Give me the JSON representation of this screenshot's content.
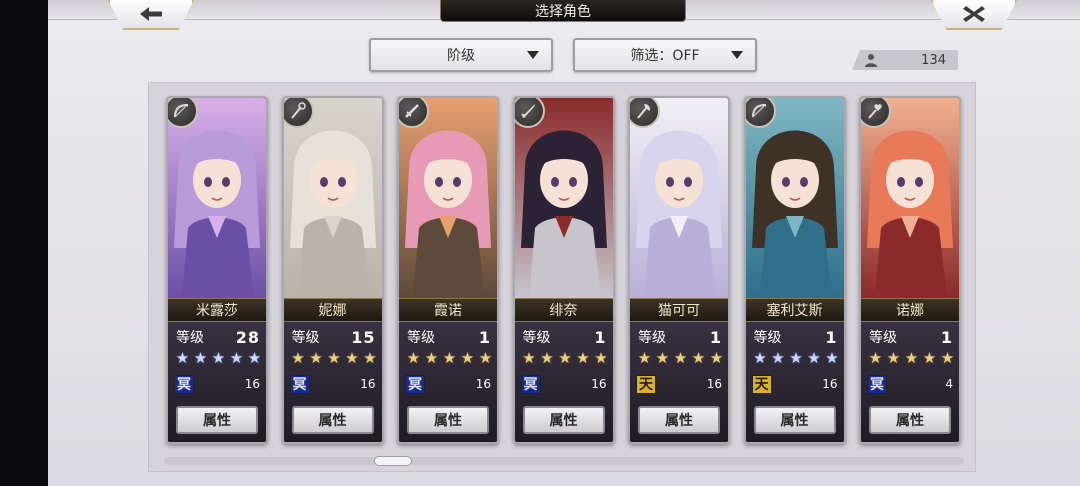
{
  "header": {
    "title": "选择角色",
    "back_icon": "back-arrow-icon",
    "close_icon": "close-icon"
  },
  "filters": {
    "grade_label": "阶级",
    "filter_label": "筛选：OFF"
  },
  "roster_count": "134",
  "level_label": "等级",
  "attribute_button": "属性",
  "characters": [
    {
      "name": "米露莎",
      "level": "28",
      "stars": 5,
      "star_color": "blue",
      "element": "冥",
      "element_type": "dark",
      "count": "16",
      "class_icon": "bow-icon"
    },
    {
      "name": "妮娜",
      "level": "15",
      "stars": 5,
      "star_color": "gold",
      "element": "冥",
      "element_type": "dark",
      "count": "16",
      "class_icon": "staff-icon"
    },
    {
      "name": "霞诺",
      "level": "1",
      "stars": 5,
      "star_color": "gold",
      "element": "冥",
      "element_type": "dark",
      "count": "16",
      "class_icon": "sword-icon"
    },
    {
      "name": "绯奈",
      "level": "1",
      "stars": 5,
      "star_color": "gold",
      "element": "冥",
      "element_type": "dark",
      "count": "16",
      "class_icon": "blade-icon"
    },
    {
      "name": "猫可可",
      "level": "1",
      "stars": 5,
      "star_color": "gold",
      "element": "天",
      "element_type": "heaven",
      "count": "16",
      "class_icon": "axe-icon"
    },
    {
      "name": "塞利艾斯",
      "level": "1",
      "stars": 5,
      "star_color": "blue",
      "element": "天",
      "element_type": "heaven",
      "count": "16",
      "class_icon": "bow-icon"
    },
    {
      "name": "诺娜",
      "level": "1",
      "stars": 5,
      "star_color": "gold",
      "element": "冥",
      "element_type": "dark",
      "count": "4",
      "class_icon": "heart-staff-icon"
    }
  ],
  "colors": {
    "portrait_0": [
      "#b79ad8",
      "#6a4fa6",
      "#d8b0e8"
    ],
    "portrait_1": [
      "#e6e2da",
      "#b9b4aa",
      "#d9d4cc"
    ],
    "portrait_2": [
      "#e79ab6",
      "#5e4a3a",
      "#e8a070"
    ],
    "portrait_3": [
      "#2b2236",
      "#c8c4cc",
      "#8a2a2a"
    ],
    "portrait_4": [
      "#d8d4ee",
      "#b8b0d8",
      "#f2f0f6"
    ],
    "portrait_5": [
      "#3e3226",
      "#2f6f8a",
      "#7fb6c2"
    ],
    "portrait_6": [
      "#e87a5a",
      "#8a2a2a",
      "#f2b090"
    ]
  }
}
